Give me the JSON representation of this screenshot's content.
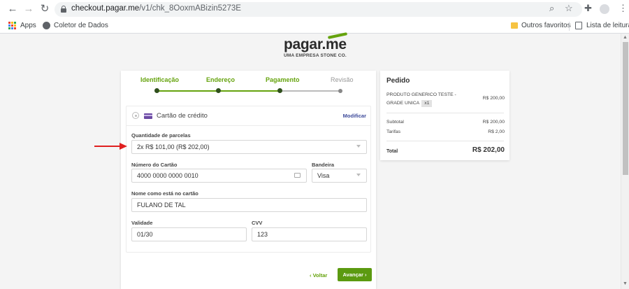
{
  "browser": {
    "url_host": "checkout.pagar.me",
    "url_path": "/v1/chk_8OoxmABizin5273E",
    "bookmarks": {
      "apps": "Apps",
      "coletor": "Coletor de Dados",
      "outros": "Outros favoritos",
      "lista": "Lista de leitura"
    }
  },
  "brand": {
    "logo": "pagar.me",
    "tagline": "UMA EMPRESA STONE CO.",
    "accent": "#65a30d"
  },
  "steps": [
    {
      "label": "Identificação",
      "active": true
    },
    {
      "label": "Endereço",
      "active": true
    },
    {
      "label": "Pagamento",
      "active": true
    },
    {
      "label": "Revisão",
      "active": false
    }
  ],
  "payment": {
    "method": "Cartão de crédito",
    "modify": "Modificar",
    "installments_label": "Quantidade de parcelas",
    "installments_value": "2x R$ 101,00 (R$ 202,00)",
    "card_number_label": "Número do Cartão",
    "card_number_value": "4000 0000 0000 0010",
    "brand_label": "Bandeira",
    "brand_value": "Visa",
    "name_label": "Nome como está no cartão",
    "name_value": "FULANO DE TAL",
    "validity_label": "Validade",
    "validity_value": "01/30",
    "cvv_label": "CVV",
    "cvv_value": "123"
  },
  "actions": {
    "back": "‹ Voltar",
    "advance": "Avançar ›"
  },
  "order": {
    "title": "Pedido",
    "product": "PRODUTO GENERICO TESTE - GRADE UNICA",
    "qty": "x1",
    "product_price": "R$ 200,00",
    "subtotal_label": "Subtotal",
    "subtotal_value": "R$ 200,00",
    "fees_label": "Tarifas",
    "fees_value": "R$ 2,00",
    "total_label": "Total",
    "total_value": "R$ 202,00"
  }
}
